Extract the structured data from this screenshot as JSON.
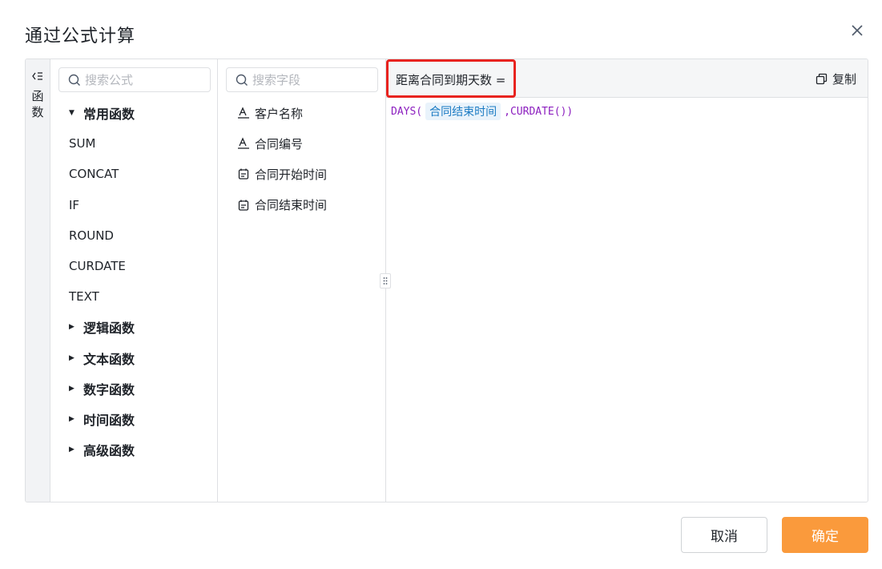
{
  "dialog": {
    "title": "通过公式计算",
    "close_icon": "close-icon"
  },
  "sidebar_toggle": {
    "label_line1": "函",
    "label_line2": "数",
    "icon": "collapse-list-icon"
  },
  "functions": {
    "search_placeholder": "搜索公式",
    "groups": [
      {
        "label": "常用函数",
        "expanded": true,
        "items": [
          "SUM",
          "CONCAT",
          "IF",
          "ROUND",
          "CURDATE",
          "TEXT"
        ]
      },
      {
        "label": "逻辑函数",
        "expanded": false
      },
      {
        "label": "文本函数",
        "expanded": false
      },
      {
        "label": "数字函数",
        "expanded": false
      },
      {
        "label": "时间函数",
        "expanded": false
      },
      {
        "label": "高级函数",
        "expanded": false
      }
    ]
  },
  "fields": {
    "search_placeholder": "搜索字段",
    "items": [
      {
        "label": "客户名称",
        "icon": "text-field-icon"
      },
      {
        "label": "合同编号",
        "icon": "text-field-icon"
      },
      {
        "label": "合同开始时间",
        "icon": "date-field-icon"
      },
      {
        "label": "合同结束时间",
        "icon": "date-field-icon"
      }
    ]
  },
  "editor": {
    "formula_name": "距离合同到期天数 =",
    "copy_label": "复制",
    "formula": {
      "prefix": "DAYS(",
      "field": "合同结束时间",
      "suffix": ",CURDATE())"
    }
  },
  "footer": {
    "cancel_label": "取消",
    "ok_label": "确定"
  },
  "colors": {
    "primary": "#fa9a3c",
    "highlight_border": "#e8231f",
    "formula_function": "#8c1fbf",
    "field_chip_bg": "#e9f3fb",
    "field_chip_text": "#1b7bc3"
  }
}
